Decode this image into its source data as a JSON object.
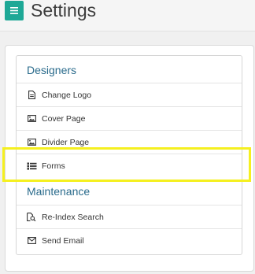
{
  "header": {
    "title": "Settings",
    "menu_icon": "hamburger-menu-icon",
    "accent_color": "#1ea896"
  },
  "designers": {
    "heading": "Designers",
    "items": [
      {
        "label": "Change Logo",
        "icon": "file-document-icon"
      },
      {
        "label": "Cover Page",
        "icon": "image-icon"
      },
      {
        "label": "Divider Page",
        "icon": "image-icon"
      },
      {
        "label": "Forms",
        "icon": "form-list-icon"
      }
    ]
  },
  "maintenance": {
    "heading": "Maintenance",
    "items": [
      {
        "label": "Re-Index Search",
        "icon": "file-search-icon"
      },
      {
        "label": "Send Email",
        "icon": "envelope-icon"
      }
    ]
  },
  "colors": {
    "heading_text": "#2a6b8c",
    "highlight": "#f5f020"
  }
}
